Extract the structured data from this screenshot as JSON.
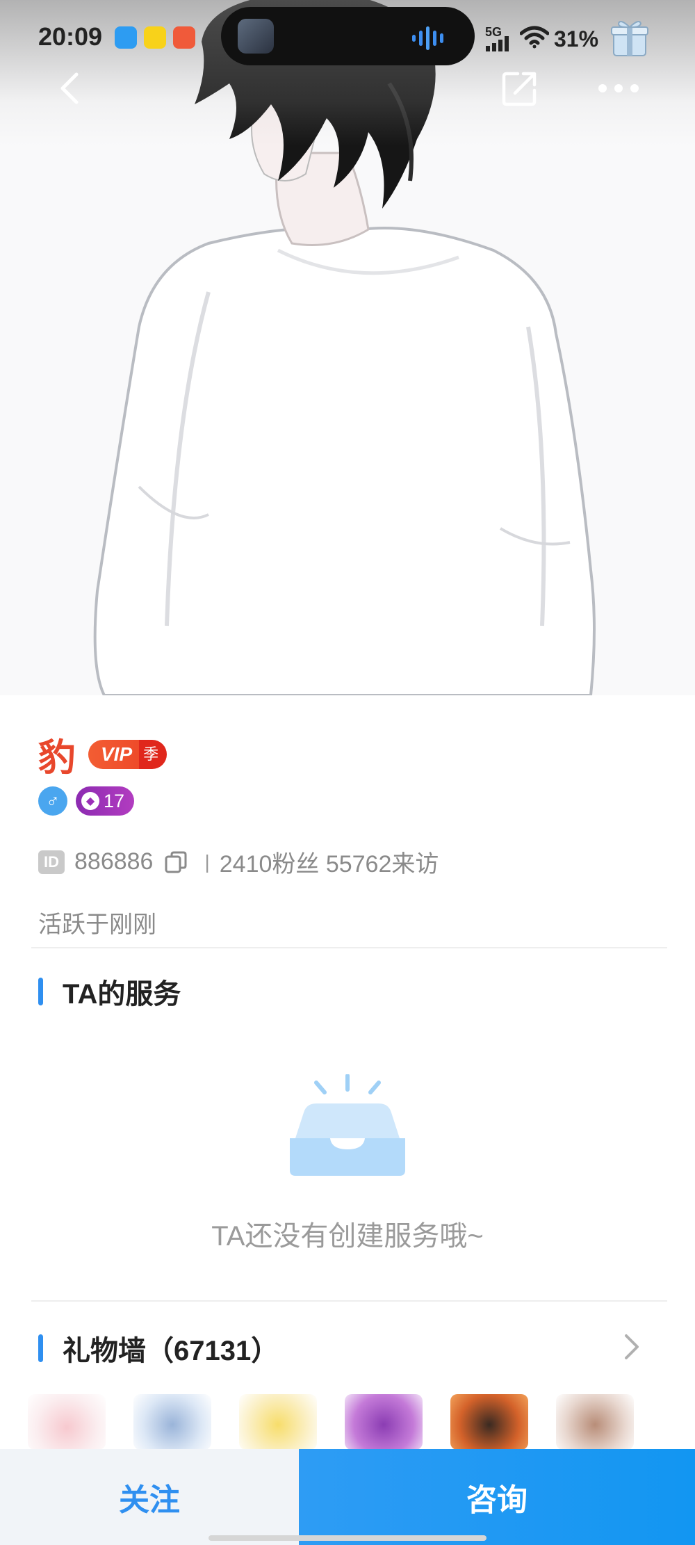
{
  "status_bar": {
    "time": "20:09",
    "network": "5G",
    "battery": "31%"
  },
  "nav": {
    "back_icon": "chevron-left-icon",
    "share_icon": "share-icon",
    "more_icon": "more-icon"
  },
  "profile": {
    "name": "豹",
    "vip_label": "VIP",
    "vip_term": "季",
    "gender_symbol": "♂",
    "level": "17",
    "id_tag": "ID",
    "id_number": "886886",
    "stats": "2410粉丝 55762来访",
    "active_status": "活跃于刚刚"
  },
  "services": {
    "title": "TA的服务",
    "empty_text": "TA还没有创建服务哦~"
  },
  "gift_wall": {
    "title": "礼物墙（67131）",
    "items": [
      "wings-gift",
      "angel-gift",
      "star-gift",
      "castle-gift",
      "car-gift",
      "couple-gift"
    ]
  },
  "actions": {
    "follow_label": "关注",
    "consult_label": "咨询"
  },
  "colors": {
    "accent": "#2f8ff0",
    "name": "#e8472c",
    "vip": "#ee4b2a",
    "level": "#9b2fb8"
  }
}
